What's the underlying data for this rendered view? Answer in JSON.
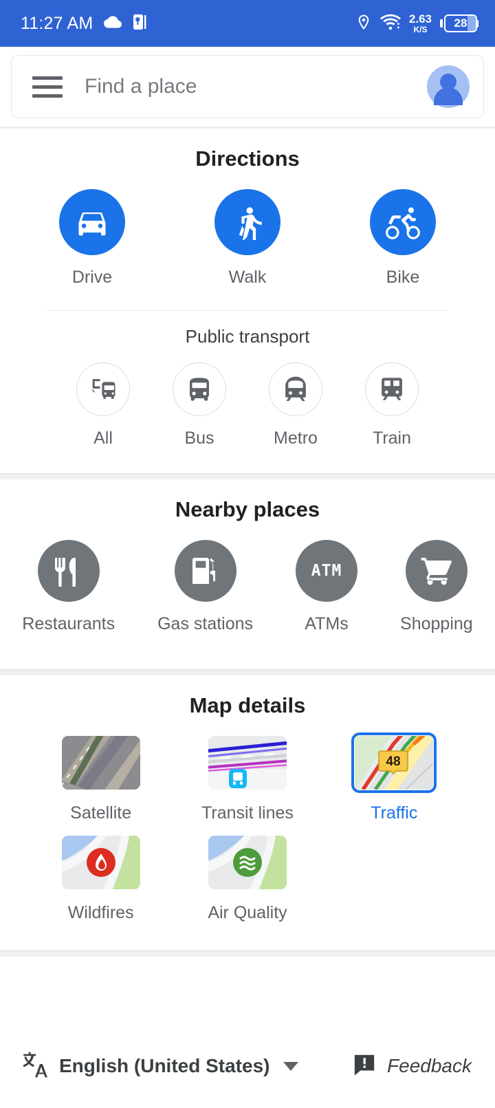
{
  "status_bar": {
    "time": "11:27 AM",
    "icons_left": [
      "cloud-icon",
      "powerpoint-icon"
    ],
    "icons_right": [
      "location-icon",
      "wifi-icon"
    ],
    "net_speed_value": "2.63",
    "net_speed_unit": "K/S",
    "battery_percent": "28",
    "background_color": "#2f63d4"
  },
  "search": {
    "placeholder": "Find a place",
    "menu_icon": "hamburger-icon",
    "avatar_icon": "account-avatar"
  },
  "directions": {
    "title": "Directions",
    "modes": [
      {
        "label": "Drive",
        "icon": "car-icon"
      },
      {
        "label": "Walk",
        "icon": "pedestrian-icon"
      },
      {
        "label": "Bike",
        "icon": "bicycle-icon"
      }
    ],
    "public_transport_title": "Public transport",
    "transit": [
      {
        "label": "All",
        "icon": "bus-train-icon"
      },
      {
        "label": "Bus",
        "icon": "bus-icon"
      },
      {
        "label": "Metro",
        "icon": "metro-icon"
      },
      {
        "label": "Train",
        "icon": "train-icon"
      }
    ]
  },
  "nearby_places": {
    "title": "Nearby places",
    "items": [
      {
        "label": "Restaurants",
        "icon": "restaurant-icon"
      },
      {
        "label": "Gas stations",
        "icon": "gas-pump-icon"
      },
      {
        "label": "ATMs",
        "icon": "atm-icon",
        "glyph": "ATM"
      },
      {
        "label": "Shopping",
        "icon": "shopping-cart-icon"
      }
    ]
  },
  "map_details": {
    "title": "Map details",
    "items": [
      {
        "label": "Satellite",
        "thumb": "satellite-thumb",
        "selected": false
      },
      {
        "label": "Transit lines",
        "thumb": "transit-lines-thumb",
        "selected": false
      },
      {
        "label": "Traffic",
        "thumb": "traffic-thumb",
        "selected": true,
        "badge": "48"
      },
      {
        "label": "Wildfires",
        "thumb": "wildfires-thumb",
        "selected": false
      },
      {
        "label": "Air Quality",
        "thumb": "air-quality-thumb",
        "selected": false
      }
    ]
  },
  "footer": {
    "language": "English (United States)",
    "language_icon": "translate-icon",
    "feedback": "Feedback",
    "feedback_icon": "feedback-icon"
  },
  "colors": {
    "accent_blue": "#1a73e8",
    "status_bar_blue": "#2f63d4",
    "gray_circle": "#70757a",
    "text_gray": "#5f6368",
    "band_gray": "#eff0f2"
  }
}
